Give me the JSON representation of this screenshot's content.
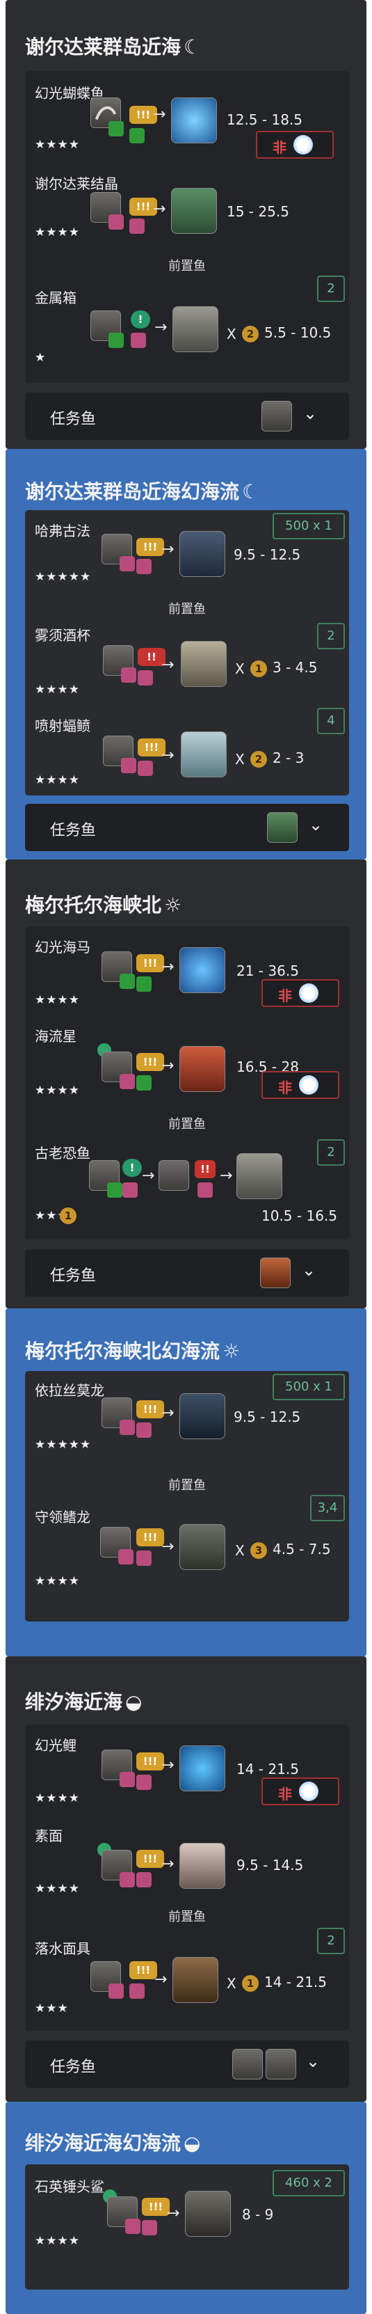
{
  "sections": [
    {
      "title": "谢尔达莱群岛近海",
      "weather_icon": "moon-icon",
      "fish": [
        {
          "name": "幻光蝴蝶鱼",
          "stars": "★★★★",
          "tug": "!!!",
          "time": "12.5 - 18.5",
          "weather": "非"
        },
        {
          "name": "谢尔达莱结晶",
          "stars": "★★★★",
          "tug": "!!!",
          "time": "15 - 25.5"
        }
      ],
      "prereq_label": "前置鱼",
      "prereq": [
        {
          "name": "金属箱",
          "stars": "★",
          "tug": "!",
          "mult": "X",
          "coin": "2",
          "time": "5.5 - 10.5",
          "count": "2"
        }
      ],
      "task_label": "任务鱼"
    },
    {
      "title": "谢尔达莱群岛近海幻海流",
      "weather_icon": "moon-icon",
      "fish": [
        {
          "name": "哈弗古法",
          "stars": "★★★★★",
          "tug": "!!!",
          "time": "9.5 - 12.5",
          "count": "500 x 1"
        }
      ],
      "prereq_label": "前置鱼",
      "prereq": [
        {
          "name": "雾须酒杯",
          "stars": "★★★★",
          "tug": "!!",
          "mult": "X",
          "coin": "1",
          "time": "3 - 4.5",
          "count": "2"
        },
        {
          "name": "喷射蝠鲼",
          "stars": "★★★★",
          "tug": "!!!",
          "mult": "X",
          "coin": "2",
          "time": "2 - 3",
          "count": "4"
        }
      ],
      "task_label": "任务鱼"
    },
    {
      "title": "梅尔托尔海峡北",
      "weather_icon": "sun-icon",
      "fish": [
        {
          "name": "幻光海马",
          "stars": "★★★★",
          "tug": "!!!",
          "time": "21 - 36.5",
          "weather": "非"
        },
        {
          "name": "海流星",
          "stars": "★★★★",
          "tug": "!!!",
          "time": "16.5 - 28",
          "weather": "非"
        }
      ],
      "prereq_label": "前置鱼",
      "prereq": [
        {
          "name": "古老恐鱼",
          "stars": "★★★",
          "tug": "!",
          "tug2": "!!",
          "coin": "1",
          "time": "10.5 - 16.5",
          "count": "2"
        }
      ],
      "task_label": "任务鱼"
    },
    {
      "title": "梅尔托尔海峡北幻海流",
      "weather_icon": "sun-icon",
      "fish": [
        {
          "name": "依拉丝莫龙",
          "stars": "★★★★★",
          "tug": "!!!",
          "time": "9.5 - 12.5",
          "count": "500 x 1"
        }
      ],
      "prereq_label": "前置鱼",
      "prereq": [
        {
          "name": "守领鳍龙",
          "stars": "★★★★",
          "tug": "!!!",
          "mult": "X",
          "coin": "3",
          "time": "4.5 - 7.5",
          "count": "3,4"
        }
      ]
    },
    {
      "title": "绯汐海近海",
      "weather_icon": "sunset-icon",
      "fish": [
        {
          "name": "幻光鲤",
          "stars": "★★★★",
          "tug": "!!!",
          "time": "14 - 21.5",
          "weather": "非"
        },
        {
          "name": "素面",
          "stars": "★★★★",
          "tug": "!!!",
          "time": "9.5 - 14.5"
        }
      ],
      "prereq_label": "前置鱼",
      "prereq": [
        {
          "name": "落水面具",
          "stars": "★★★",
          "tug": "!!!",
          "mult": "X",
          "coin": "1",
          "time": "14 - 21.5",
          "count": "2"
        }
      ],
      "task_label": "任务鱼"
    },
    {
      "title": "绯汐海近海幻海流",
      "weather_icon": "sunset-icon",
      "fish": [
        {
          "name": "石英锤头鲨",
          "stars": "★★★★",
          "tug": "!!!",
          "time": "8 - 9",
          "count": "460 x 2"
        }
      ]
    }
  ],
  "colors": {
    "dark_section": "#2c2d30",
    "blue_section": "#3b70b8",
    "weather_border": "#a03234",
    "count_border": "#3e7f5e"
  }
}
